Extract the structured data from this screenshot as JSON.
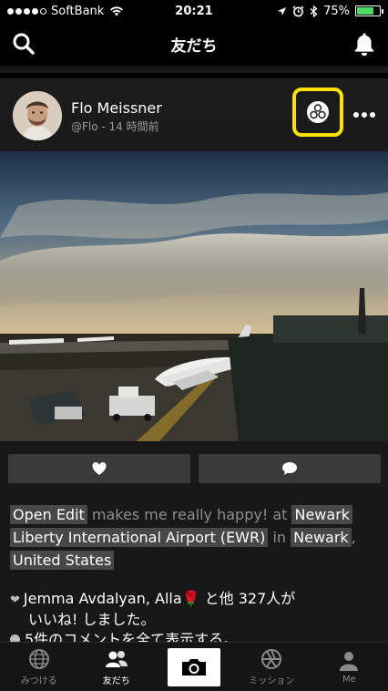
{
  "status_bar": {
    "carrier": "SoftBank",
    "time": "20:21",
    "battery": "75%",
    "signal_filled": 4,
    "battery_level": 0.75,
    "battery_color": "#4cd964"
  },
  "nav": {
    "title": "友だち",
    "left_icon": "search-icon",
    "right_icon": "bell-icon"
  },
  "post": {
    "user_name": "Flo Meissner",
    "user_meta": "@Flo - 14 時間前",
    "highlight_color": "#ffe000",
    "caption": {
      "tag1": "Open Edit",
      "text1": " makes me really happy! at ",
      "tag2": "Newark",
      "tag3": "Liberty International Airport (EWR)",
      "text2": " in ",
      "tag4": "Newark",
      "text3": ",",
      "tag5": "United States"
    },
    "likes_line1": "Jemma Avdalyan, Alla🌹 と他 327人が",
    "likes_line2": "いいね! しました。",
    "comments_text": "5件のコメントを全て表示する。",
    "actions": [
      "heart-icon",
      "comment-icon"
    ]
  },
  "tabs": [
    {
      "label": "みつける",
      "icon": "globe-icon",
      "active": false
    },
    {
      "label": "友だち",
      "icon": "friends-icon",
      "active": true
    },
    {
      "label": "",
      "icon": "camera-icon",
      "active": false
    },
    {
      "label": "ミッション",
      "icon": "aperture-icon",
      "active": false
    },
    {
      "label": "Me",
      "icon": "person-icon",
      "active": false
    }
  ]
}
